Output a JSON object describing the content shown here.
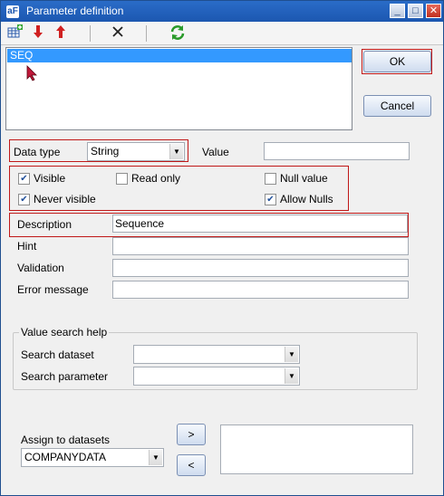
{
  "window": {
    "title": "Parameter definition",
    "icon_text": "aF"
  },
  "titlebar_buttons": {
    "minimize": "_",
    "maximize": "□",
    "close": "✕"
  },
  "toolbar": {
    "icons": [
      "add-grid-icon",
      "arrow-down-red-icon",
      "arrow-up-red-icon",
      "delete-x-icon",
      "refresh-green-icon"
    ]
  },
  "params_list": {
    "items": [
      "SEQ"
    ]
  },
  "buttons": {
    "ok": "OK",
    "cancel": "Cancel"
  },
  "form": {
    "data_type_label": "Data type",
    "data_type_value": "String",
    "value_label": "Value",
    "value_value": "",
    "visible_label": "Visible",
    "visible_checked": true,
    "read_only_label": "Read only",
    "read_only_checked": false,
    "null_value_label": "Null value",
    "null_value_checked": false,
    "never_visible_label": "Never visible",
    "never_visible_checked": true,
    "allow_nulls_label": "Allow Nulls",
    "allow_nulls_checked": true,
    "description_label": "Description",
    "description_value": "Sequence",
    "hint_label": "Hint",
    "hint_value": "",
    "validation_label": "Validation",
    "validation_value": "",
    "error_message_label": "Error message",
    "error_message_value": ""
  },
  "value_search": {
    "group_label": "Value search help",
    "dataset_label": "Search dataset",
    "dataset_value": "",
    "parameter_label": "Search parameter",
    "parameter_value": ""
  },
  "assign": {
    "label": "Assign to datasets",
    "dataset_value": "COMPANYDATA",
    "add_button": ">",
    "remove_button": "<"
  },
  "colors": {
    "selection": "#3399ff",
    "highlight_border": "#c01818",
    "title_bar": "#2a6cc8"
  }
}
